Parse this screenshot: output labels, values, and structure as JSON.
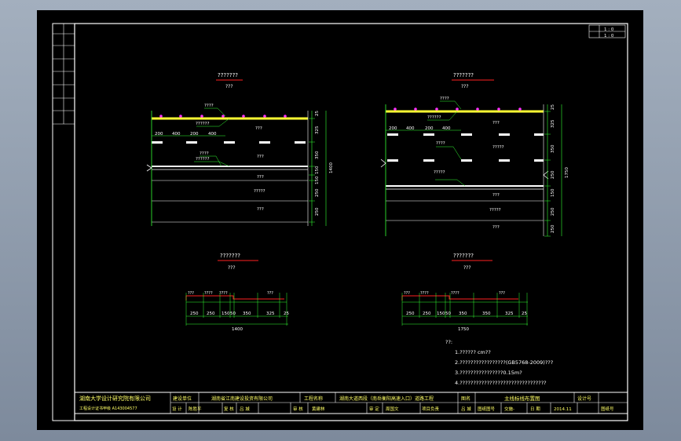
{
  "corner_table": {
    "row1": "1 : 0",
    "row2": "1 : 0"
  },
  "drawings": {
    "left": {
      "title": "???????",
      "subtitle": "???",
      "dims_right": [
        "25",
        "325",
        "350",
        "150",
        "150",
        "250",
        "250"
      ],
      "total_height": "1400",
      "lane_dims": [
        "200",
        "400",
        "200",
        "400"
      ],
      "labels": [
        "????",
        "??????",
        "???",
        "????",
        "??????",
        "???",
        "???",
        "?????",
        "???"
      ],
      "bottom_title": "???????",
      "bottom_subtitle": "???",
      "bottom_dims": [
        "250",
        "250",
        "150",
        "50",
        "350",
        "325",
        "25"
      ],
      "bottom_total": "1400",
      "bottom_labels": [
        "???",
        "????",
        "????",
        "???"
      ]
    },
    "right": {
      "title": "???????",
      "subtitle": "???",
      "dims_right": [
        "25",
        "325",
        "350",
        "250",
        "150",
        "250",
        "250"
      ],
      "total_height": "1750",
      "lane_dims": [
        "200",
        "400",
        "200",
        "400"
      ],
      "labels": [
        "????",
        "??????",
        "???",
        "????",
        "?????",
        "?????",
        "???",
        "?????",
        "???"
      ],
      "bottom_title": "???????",
      "bottom_subtitle": "???",
      "bottom_dims": [
        "250",
        "250",
        "150",
        "50",
        "350",
        "350",
        "325",
        "25"
      ],
      "bottom_total": "1750",
      "bottom_labels": [
        "???",
        "????",
        "????",
        "???"
      ]
    }
  },
  "notes": {
    "heading": "??:",
    "items": [
      "1.?????? cm??",
      "2.?????????????????(GB5768-2009)???",
      "3.????????????????0.15m?",
      "4.????????????????????????????????"
    ]
  },
  "title_block": {
    "company": "湖南大学设计研究院有限公司",
    "company_sub": "工程设计证书甲级 A143004577",
    "build_unit_label": "建设单位",
    "build_unit": "湖南省江南建设投资有限公司",
    "project_label": "工程名称",
    "project_name": "湖南大道西段（南岳衡阳高速入口）道路工程",
    "drawing_label": "图名",
    "drawing_name": "主线标线布置图",
    "design_no_label": "设计号",
    "row2": [
      "设 计",
      "陈胜平",
      "复 核",
      "吕 城",
      "审 核",
      "黄建林",
      "审 定",
      "周国文",
      "项目负责",
      "吕 城",
      "图纸图号",
      "交施-",
      "日 期",
      "2014.11",
      "图纸号"
    ]
  },
  "colors": {
    "yellow": "#ffff33",
    "red": "#ff2020",
    "green": "#33ff33",
    "magenta": "#ff33ff",
    "white": "#ffffff"
  }
}
